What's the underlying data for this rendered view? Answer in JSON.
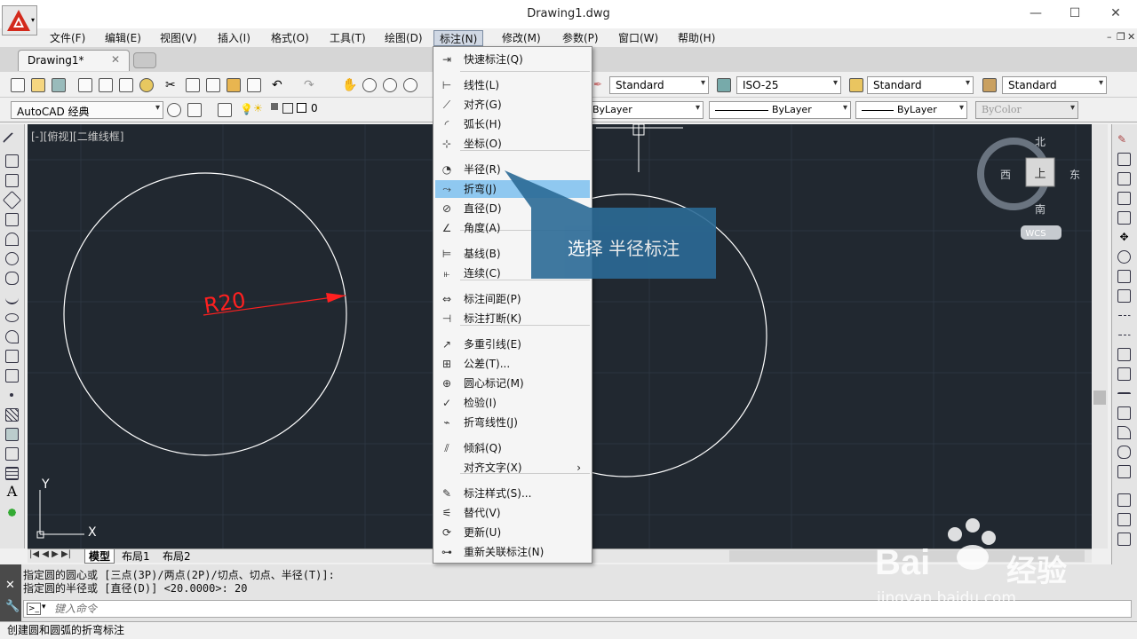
{
  "window": {
    "title": "Drawing1.dwg",
    "min": "—",
    "max": "☐",
    "close": "✕"
  },
  "menubar": [
    "文件(F)",
    "编辑(E)",
    "视图(V)",
    "插入(I)",
    "格式(O)",
    "工具(T)",
    "绘图(D)",
    "标注(N)",
    "修改(M)",
    "参数(P)",
    "窗口(W)",
    "帮助(H)"
  ],
  "doc_tab": {
    "name": "Drawing1*",
    "close": "✕"
  },
  "toolbar1": {
    "textstyle": "Standard",
    "dimstyle": "ISO-25",
    "tablestyle": "Standard",
    "mleaderstyle": "Standard"
  },
  "toolbar2": {
    "workspace": "AutoCAD 经典",
    "layer": "0",
    "color": "ByLayer",
    "linetype": "ByLayer",
    "lineweight": "ByLayer",
    "plotstyle": "ByColor"
  },
  "viewport_label": "[-][俯视][二维线框]",
  "viewcube": {
    "north": "北",
    "south": "南",
    "east": "东",
    "west": "西",
    "face": "上",
    "wcs": "WCS"
  },
  "ucs": {
    "x": "X",
    "y": "Y"
  },
  "dimension_text": "R20",
  "dim_menu": {
    "items": [
      {
        "label": "快速标注(Q)",
        "icon": "quick-dim-icon"
      },
      {
        "label": "线性(L)",
        "icon": "linear-icon"
      },
      {
        "label": "对齐(G)",
        "icon": "aligned-icon"
      },
      {
        "label": "弧长(H)",
        "icon": "arc-length-icon"
      },
      {
        "label": "坐标(O)",
        "icon": "ordinate-icon"
      },
      {
        "label": "半径(R)",
        "icon": "radius-icon"
      },
      {
        "label": "折弯(J)",
        "icon": "jogged-icon"
      },
      {
        "label": "直径(D)",
        "icon": "diameter-icon"
      },
      {
        "label": "角度(A)",
        "icon": "angular-icon"
      },
      {
        "label": "基线(B)",
        "icon": "baseline-icon"
      },
      {
        "label": "连续(C)",
        "icon": "continue-icon"
      },
      {
        "label": "标注间距(P)",
        "icon": "dim-space-icon"
      },
      {
        "label": "标注打断(K)",
        "icon": "dim-break-icon"
      },
      {
        "label": "多重引线(E)",
        "icon": "mleader-icon"
      },
      {
        "label": "公差(T)...",
        "icon": "tolerance-icon"
      },
      {
        "label": "圆心标记(M)",
        "icon": "center-mark-icon"
      },
      {
        "label": "检验(I)",
        "icon": "inspect-icon"
      },
      {
        "label": "折弯线性(J)",
        "icon": "jog-linear-icon"
      },
      {
        "label": "倾斜(Q)",
        "icon": "oblique-icon"
      },
      {
        "label": "对齐文字(X)",
        "icon": ""
      },
      {
        "label": "标注样式(S)...",
        "icon": "dim-style-icon"
      },
      {
        "label": "替代(V)",
        "icon": "override-icon"
      },
      {
        "label": "更新(U)",
        "icon": "update-icon"
      },
      {
        "label": "重新关联标注(N)",
        "icon": "reassociate-icon"
      }
    ],
    "highlighted": "折弯(J)",
    "submenu_arrow": "›"
  },
  "callout": "选择 半径标注",
  "layout_tabs": [
    "模型",
    "布局1",
    "布局2"
  ],
  "command_history": [
    "指定圆的圆心或 [三点(3P)/两点(2P)/切点、切点、半径(T)]:",
    "指定圆的半径或 [直径(D)] <20.0000>: 20"
  ],
  "command_input": {
    "placeholder": "键入命令"
  },
  "status_text": "创建圆和圆弧的折弯标注",
  "watermark": {
    "brand": "Bai",
    "brand2": "经验",
    "url": "jingyan.baidu.com"
  },
  "colors": {
    "canvas": "#212830",
    "dim": "#ff2020",
    "highlight": "#8fc8f0",
    "callout": "#2b6a96"
  }
}
